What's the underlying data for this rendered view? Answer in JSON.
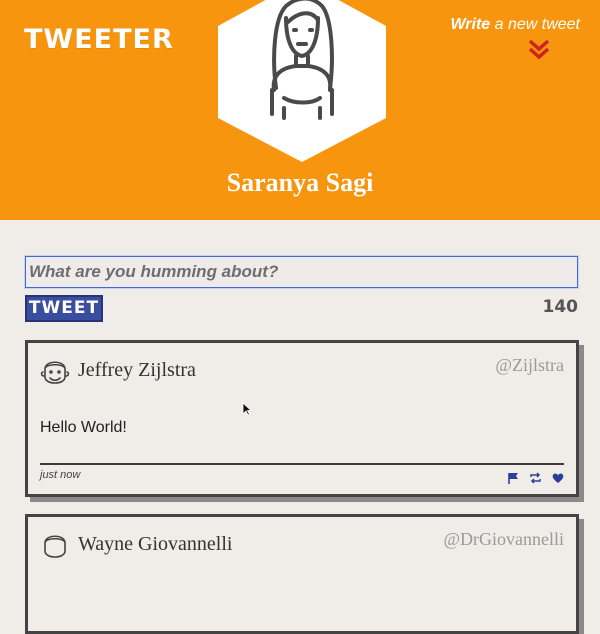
{
  "header": {
    "brand": "TWEETER",
    "write_link_bold": "Write",
    "write_link_rest": " a new tweet",
    "user_name": "Saranya Sagi"
  },
  "composer": {
    "placeholder": "What are you humming about?",
    "tweet_button": "TWEET",
    "char_count": "140"
  },
  "tweets": [
    {
      "name": "Jeffrey Zijlstra",
      "handle": "@Zijlstra",
      "body": "Hello World!",
      "time": "just now",
      "icons": [
        "flag-icon",
        "retweet-icon",
        "heart-icon"
      ]
    },
    {
      "name": "Wayne Giovannelli",
      "handle": "@DrGiovannelli"
    }
  ],
  "colors": {
    "header_bg": "#f7960e",
    "page_bg": "#f0ece8",
    "button_blue": "#3a4ea0",
    "accent_red": "#d42020",
    "icon_blue": "#2c3e9a"
  }
}
